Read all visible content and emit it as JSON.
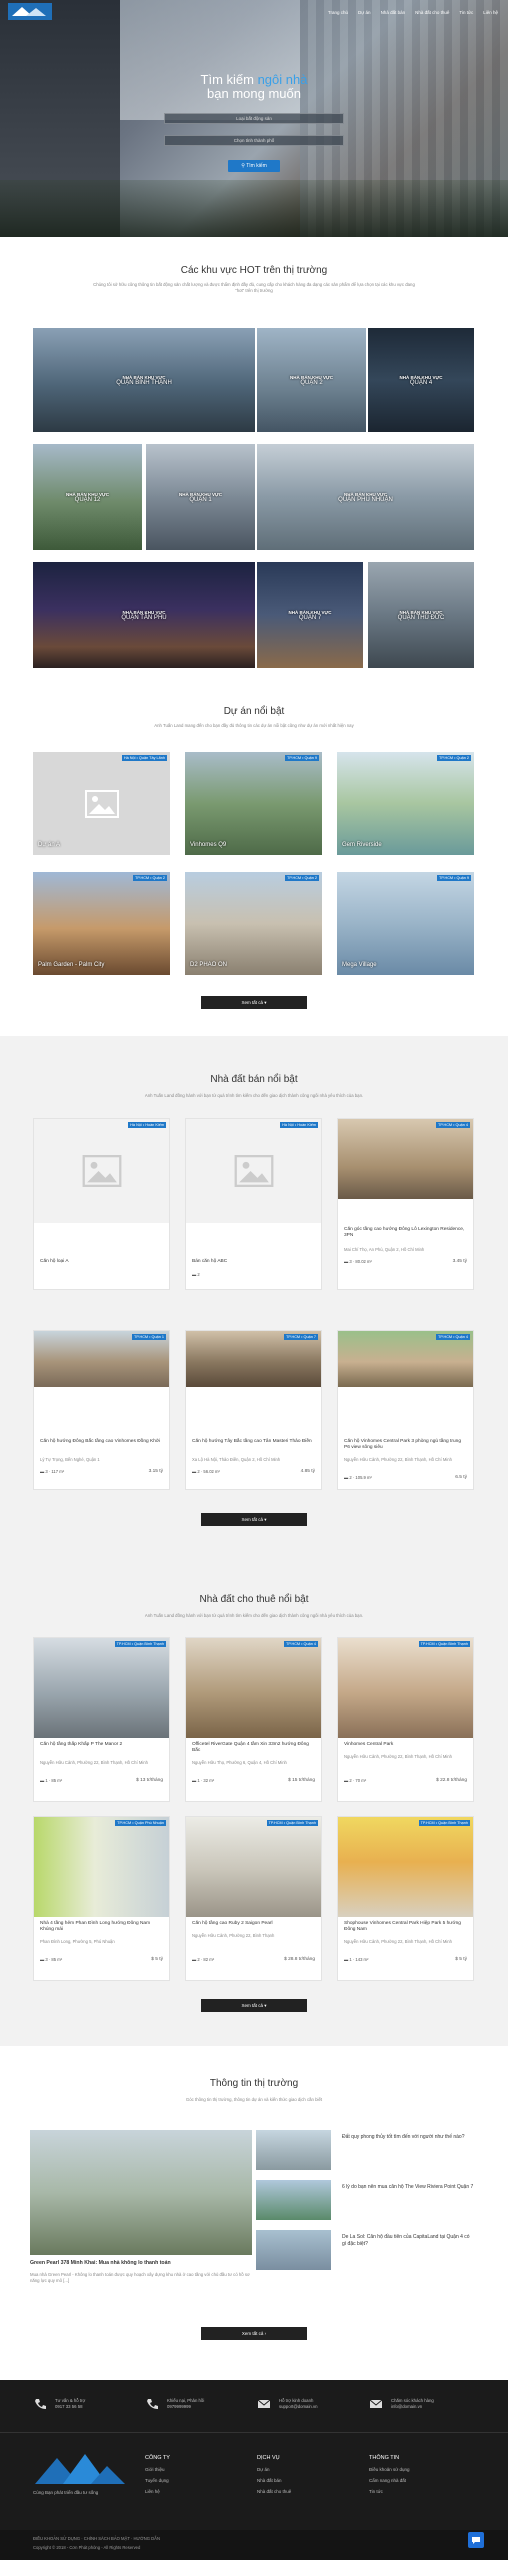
{
  "header": {
    "nav": [
      "Trang chủ",
      "Dự án",
      "Nhà đất bán",
      "Nhà đất cho thuê",
      "Tin tức",
      "Liên hệ"
    ]
  },
  "hero": {
    "title_pre": "Tìm kiếm ",
    "title_hl": "ngôi nhà",
    "title_post": "bạn mong muốn",
    "location_placeholder": "Loại bất động sản",
    "district_placeholder": "Chọn tỉnh thành phố",
    "search_label": "Tìm kiếm"
  },
  "areas": {
    "title": "Các khu vực HOT trên thị trường",
    "subtitle": "Chúng tôi sở hữu công thông tin bất động sản chất lượng và được thẩm định đầy đủ, cung cấp cho khách hàng đa dạng các sản phẩm để lựa chọn tại các khu vực đang \"hot\" trên thị trường",
    "sale_label": "NHÀ BÁN KHU VỰC",
    "items": [
      "QUẬN BÌNH THẠNH",
      "QUẬN 2",
      "QUẬN 4",
      "QUẬN 12",
      "QUẬN 1",
      "QUẬN PHÚ NHUẬN",
      "QUẬN TÂN PHÚ",
      "QUẬN 7",
      "QUẬN THỦ ĐỨC"
    ]
  },
  "projects": {
    "title": "Dự án nổi bật",
    "subtitle": "Anh Tuấn Land mang đến cho bạn đầy đủ thông tin các dự án nổi bật cũng như dự án mới nhất hiện nay",
    "items": [
      {
        "badge": "Hà Nội • Quận Tây Lãnh",
        "name": "Dự án A"
      },
      {
        "badge": "TP.HCM • Quận 9",
        "name": "Vinhomes Q9"
      },
      {
        "badge": "TP.HCM • Quận 2",
        "name": "Gem Riverside"
      },
      {
        "badge": "TP.HCM • Quận 2",
        "name": "Palm Garden - Palm City"
      },
      {
        "badge": "TP.HCM • Quận 2",
        "name": "D2 PHAO ON"
      },
      {
        "badge": "TP.HCM • Quận 9",
        "name": "Mega Village"
      }
    ],
    "more": "Xem tất cả"
  },
  "sale": {
    "title": "Nhà đất bán nổi bật",
    "subtitle": "Anh Tuấn Land đồng hành với bạn từ quá trình tìm kiếm cho đến giao dịch thành công ngôi nhà yêu thích của bạn.",
    "items": [
      {
        "badge": "Hà Nội • Hoàn Kiếm",
        "title": "Căn hộ loại A",
        "addr": "",
        "meta": "",
        "price": ""
      },
      {
        "badge": "Hà Nội • Hoàn Kiếm",
        "title": "Bán căn hộ ABC",
        "addr": "",
        "meta": "2",
        "price": ""
      },
      {
        "badge": "TP.HCM • Quận 4",
        "title": "Căn góc tầng cao hướng Đông Lô Lexington Residence, 3PN",
        "addr": "Mai Chí Thọ, An Phú, Quận 2, Hồ Chí Minh",
        "meta": "3 · 80.02 m²",
        "price": "3.45 tỷ"
      },
      {
        "badge": "TP.HCM • Quận 1",
        "title": "Căn hộ hướng Đông Bắc tầng cao Vinhomes Đồng Khởi",
        "addr": "Lý Tự Trọng, Bến Nghé, Quận 1",
        "meta": "3 · 117 m²",
        "price": "3.15 tỷ"
      },
      {
        "badge": "TP.HCM • Quận 7",
        "title": "Căn hộ hướng Tây Bắc tầng cao Tân Masteri Thảo Điền",
        "addr": "Xa Lộ Hà Nội, Thảo Điền, Quận 2, Hồ Chí Minh",
        "meta": "2 · 56.02 m²",
        "price": "4.85 tỷ"
      },
      {
        "badge": "TP.HCM • Quận 4",
        "title": "Căn hộ Vinhomes Central Park 3 phòng ngủ tầng trung P6 view sông siêu",
        "addr": "Nguyễn Hữu Cảnh, Phường 22, Bình Thạnh, Hồ Chí Minh",
        "meta": "2 · 105.9 m²",
        "price": "6.5 tỷ"
      }
    ],
    "more": "Xem tất cả"
  },
  "rent": {
    "title": "Nhà đất cho thuê nổi bật",
    "subtitle": "Anh Tuấn Land đồng hành với bạn từ quá trình tìm kiếm cho đến giao dịch thành công ngôi nhà yêu thích của bạn.",
    "items": [
      {
        "badge": "TP.HCM • Quận Bình Thạnh",
        "title": "Căn hộ tầng thấp Khấp P The Manor 2",
        "addr": "Nguyễn Hữu Cảnh, Phường 22, Bình Thạnh, Hồ Chí Minh",
        "meta": "1 · 85 m²",
        "price": "$ 13 tr/tháng"
      },
      {
        "badge": "TP.HCM • Quận 4",
        "title": "Officetel RiverGate Quận 4 tầm Xin 33m2 hướng Đông Bắc",
        "addr": "Nguyễn Hữu Thọ, Phường 6, Quận 4, Hồ Chí Minh",
        "meta": "1 · 32 m²",
        "price": "$ 15 tr/tháng"
      },
      {
        "badge": "TP.HCM • Quận Bình Thạnh",
        "title": "Vinhomes Central Park",
        "addr": "Nguyễn Hữu Cảnh, Phường 22, Bình Thạnh, Hồ Chí Minh",
        "meta": "2 · 70 m²",
        "price": "$ 22.8 tr/tháng"
      },
      {
        "badge": "TP.HCM • Quận Phú Nhuận",
        "title": "Nhà 4 tầng hẻm Phan Đình Long hướng Đông Nam Khúng mái",
        "addr": "Phan Đình Long, Phường 5, Phú Nhuận",
        "meta": "3 · 85 m²",
        "price": "$ 5 tỷ"
      },
      {
        "badge": "TP.HCM • Quận Bình Thạnh",
        "title": "Căn hộ tầng cao Ruby 2 Saigon Pearl",
        "addr": "Nguyễn Hữu Cảnh, Phường 22, Bình Thạnh",
        "meta": "2 · 82 m²",
        "price": "$ 28.8 tr/tháng"
      },
      {
        "badge": "TP.HCM • Quận Bình Thạnh",
        "title": "Shophouse Vinhomes Central Park Hiệp Park 5 hướng Đông Nam",
        "addr": "Nguyễn Hữu Cảnh, Phường 22, Bình Thạnh, Hồ Chí Minh",
        "meta": "1 · 143 m²",
        "price": "$ 5 tỷ"
      }
    ],
    "more": "Xem tất cả"
  },
  "news": {
    "title": "Thông tin thị trường",
    "subtitle": "Góc thông tin thị trường, thông tin dự án và kiến thức giao dịch cần biết",
    "main_title": "Green Pearl 378 Minh Khai: Mua nhà không lo thanh toán",
    "main_desc": "Mua nhà Green Pearl - Không lo thanh toán được quy hoạch xây dựng khu nhà ở cao tầng với chủ đầu tư có hồ sơ năng lực quy mô [...]",
    "items": [
      "Đất quy phong thủy tốt tìm đến với người như thế nào?",
      "6 lý do bạn nên mua căn hộ The View Riviera Point Quận 7",
      "De La Sol: Căn hộ đầu tiên của CapitaLand tại Quận 4 có gì đặc biệt?"
    ],
    "more": "Xem tất cả"
  },
  "footer": {
    "contacts": [
      {
        "l1": "Tư vấn & hỗ trợ",
        "l2": "0917 33 56 58"
      },
      {
        "l1": "Khiếu nại, Phản hồi",
        "l2": "0979999999"
      },
      {
        "l1": "Hỗ trợ kinh doanh",
        "l2": "support@domain.vn"
      },
      {
        "l1": "Chăm sóc khách hàng",
        "l2": "info@domain.vn"
      }
    ],
    "tagline": "Cùng Bạn phát triển đầu tư sống",
    "cols": [
      {
        "h": "CÔNG TY",
        "items": [
          "Giới thiệu",
          "Tuyển dụng",
          "Liên hệ"
        ]
      },
      {
        "h": "DỊCH VỤ",
        "items": [
          "Dự án",
          "Nhà đất bán",
          "Nhà đất cho thuê"
        ]
      },
      {
        "h": "THÔNG TIN",
        "items": [
          "Điều khoản sử dụng",
          "Cẩm nang nhà đất",
          "Tin tức"
        ]
      }
    ],
    "bottom": "ĐIỀU KHOẢN SỬ DỤNG · CHÍNH SÁCH BẢO MẬT · HƯỚNG DẪN",
    "copy": "Copyright © 2018 - Cơn Phát phòng - All Rights Reserved"
  }
}
